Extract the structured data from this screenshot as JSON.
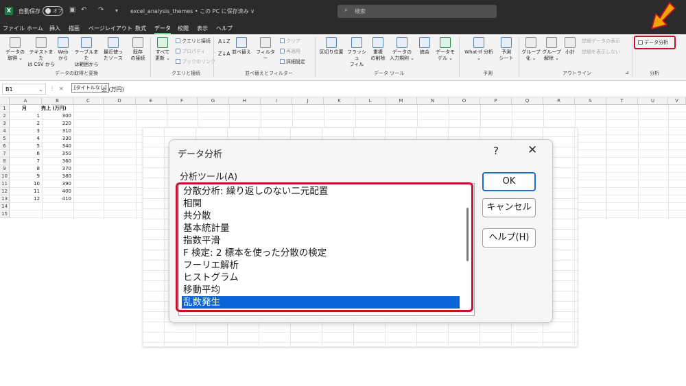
{
  "titlebar": {
    "autosave": "自動保存",
    "autosave_state": "オフ",
    "filename": "excel_analysis_themes • この PC に保存済み ∨",
    "search_placeholder": "検索"
  },
  "menu": {
    "tabs": [
      "ファイル",
      "ホーム",
      "挿入",
      "描画",
      "ページレイアウト",
      "数式",
      "データ",
      "校閲",
      "表示",
      "ヘルプ"
    ],
    "active_tab": "データ"
  },
  "ribbon": {
    "get_data": {
      "buttons": [
        {
          "l1": "データの",
          "l2": "取得 ⌄"
        },
        {
          "l1": "テキストまた",
          "l2": "は CSV から"
        },
        {
          "l1": "Web",
          "l2": "から"
        },
        {
          "l1": "テーブルまた",
          "l2": "は範囲から"
        },
        {
          "l1": "最近使っ",
          "l2": "たソース"
        },
        {
          "l1": "既存",
          "l2": "の接続"
        }
      ],
      "label": "データの取得と変換"
    },
    "queries": {
      "refresh": {
        "l1": "すべて",
        "l2": "更新 ⌄"
      },
      "queries_connections": "クエリと接続",
      "properties": "プロパティ",
      "edit_links": "ブックのリンク",
      "label": "クエリと接続"
    },
    "sort_filter": {
      "sort": "並べ替え",
      "filter": "フィルター",
      "clear": "クリア",
      "reapply": "再適用",
      "advanced": "詳細設定",
      "label": "並べ替えとフィルター"
    },
    "data_tools": {
      "buttons": [
        {
          "l1": "区切り位置",
          "l2": ""
        },
        {
          "l1": "フラッシュ",
          "l2": "フィル"
        },
        {
          "l1": "重複",
          "l2": "の削除"
        },
        {
          "l1": "データの",
          "l2": "入力規則 ⌄"
        },
        {
          "l1": "統合",
          "l2": ""
        },
        {
          "l1": "データモ",
          "l2": "デル ⌄"
        }
      ],
      "label": "データ ツール"
    },
    "forecast": {
      "what_if": {
        "l1": "What-If 分析",
        "l2": "⌄"
      },
      "forecast_sheet": {
        "l1": "予測",
        "l2": "シート"
      },
      "label": "予測"
    },
    "outline": {
      "group": {
        "l1": "グループ",
        "l2": "化 ⌄"
      },
      "ungroup": {
        "l1": "グループ",
        "l2": "解除 ⌄"
      },
      "subtotal": {
        "l1": "小計",
        "l2": ""
      },
      "show_detail": "詳細データの表示",
      "hide_detail": "詳細を表示しない",
      "label": "アウトライン"
    },
    "analysis": {
      "data_analysis": "データ分析",
      "label": "分析"
    }
  },
  "formula_bar": {
    "name_box": "B1",
    "fx": "fx",
    "tooltip": "[タイトルなし]",
    "content": "上 (万円)"
  },
  "sheet": {
    "columns": [
      "A",
      "B",
      "C",
      "D",
      "E",
      "F",
      "G",
      "H",
      "I",
      "J",
      "K",
      "L",
      "M",
      "N",
      "O",
      "P",
      "Q",
      "R",
      "S",
      "T",
      "U",
      "V"
    ],
    "rows": [
      "1",
      "2",
      "3",
      "4",
      "5",
      "6",
      "7",
      "8",
      "9",
      "10",
      "11",
      "12",
      "13",
      "14",
      "15"
    ],
    "header_a": "月",
    "header_b": "売上 (万円)",
    "data": [
      [
        "1",
        "300"
      ],
      [
        "2",
        "320"
      ],
      [
        "3",
        "310"
      ],
      [
        "4",
        "330"
      ],
      [
        "5",
        "340"
      ],
      [
        "6",
        "350"
      ],
      [
        "7",
        "360"
      ],
      [
        "8",
        "370"
      ],
      [
        "9",
        "380"
      ],
      [
        "10",
        "390"
      ],
      [
        "11",
        "400"
      ],
      [
        "12",
        "410"
      ]
    ]
  },
  "dialog": {
    "title": "データ分析",
    "help_symbol": "?",
    "close_symbol": "✕",
    "tools_label": "分析ツール(A)",
    "tools": [
      "分散分析: 繰り返しのない二元配置",
      "相関",
      "共分散",
      "基本統計量",
      "指数平滑",
      "F 検定:  2 標本を使った分散の検定",
      "フーリエ解析",
      "ヒストグラム",
      "移動平均",
      "乱数発生"
    ],
    "selected_tool": "乱数発生",
    "buttons": {
      "ok": "OK",
      "cancel": "キャンセル",
      "help": "ヘルプ(H)"
    }
  },
  "colors": {
    "highlight_red": "#c8102e",
    "arrow_orange": "#f0a400",
    "selection_blue": "#0a64d8",
    "excel_green": "#1d7a45"
  }
}
